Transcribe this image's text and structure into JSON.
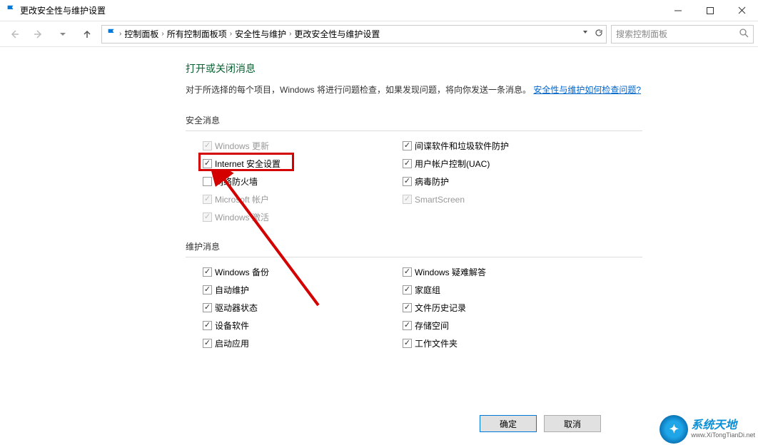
{
  "window": {
    "title": "更改安全性与维护设置"
  },
  "breadcrumbs": {
    "items": [
      "控制面板",
      "所有控制面板项",
      "安全性与维护",
      "更改安全性与维护设置"
    ]
  },
  "search": {
    "placeholder": "搜索控制面板"
  },
  "page": {
    "heading": "打开或关闭消息",
    "description": "对于所选择的每个项目，Windows 将进行问题检查，如果发现问题，将向你发送一条消息。",
    "help_link": "安全性与维护如何检查问题?"
  },
  "sections": {
    "security_label": "安全消息",
    "maintenance_label": "维护消息"
  },
  "security_items": [
    {
      "label": "Windows 更新",
      "checked": true,
      "disabled": true
    },
    {
      "label": "间谍软件和垃圾软件防护",
      "checked": true,
      "disabled": false
    },
    {
      "label": "Internet 安全设置",
      "checked": true,
      "disabled": false
    },
    {
      "label": "用户帐户控制(UAC)",
      "checked": true,
      "disabled": false
    },
    {
      "label": "网络防火墙",
      "checked": false,
      "disabled": false,
      "highlighted": true
    },
    {
      "label": "病毒防护",
      "checked": true,
      "disabled": false
    },
    {
      "label": "Microsoft 帐户",
      "checked": true,
      "disabled": true
    },
    {
      "label": "SmartScreen",
      "checked": true,
      "disabled": true
    },
    {
      "label": "Windows 激活",
      "checked": true,
      "disabled": true
    }
  ],
  "maintenance_items": [
    {
      "label": "Windows 备份",
      "checked": true
    },
    {
      "label": "Windows 疑难解答",
      "checked": true
    },
    {
      "label": "自动维护",
      "checked": true
    },
    {
      "label": "家庭组",
      "checked": true
    },
    {
      "label": "驱动器状态",
      "checked": true
    },
    {
      "label": "文件历史记录",
      "checked": true
    },
    {
      "label": "设备软件",
      "checked": true
    },
    {
      "label": "存储空间",
      "checked": true
    },
    {
      "label": "启动应用",
      "checked": true
    },
    {
      "label": "工作文件夹",
      "checked": true
    }
  ],
  "buttons": {
    "ok": "确定",
    "cancel": "取消"
  },
  "watermark": {
    "zh": "系统天地",
    "en": "www.XiTongTianDi.net"
  }
}
